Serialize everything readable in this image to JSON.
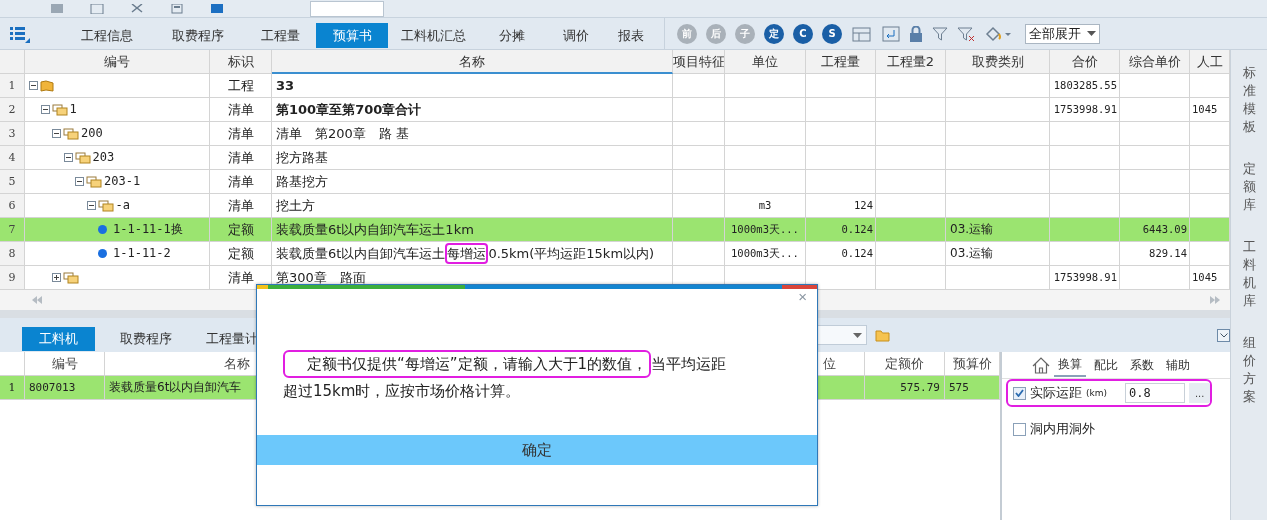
{
  "tabs": [
    {
      "label": "工程信息",
      "selected": false
    },
    {
      "label": "取费程序",
      "selected": false
    },
    {
      "label": "工程量",
      "selected": false
    },
    {
      "label": "预算书",
      "selected": true
    },
    {
      "label": "工料机汇总",
      "selected": false
    },
    {
      "label": "分摊",
      "selected": false
    },
    {
      "label": "调价",
      "selected": false
    },
    {
      "label": "报表",
      "selected": false
    }
  ],
  "tool_buttons": [
    {
      "glyph": "前",
      "disabled": true
    },
    {
      "glyph": "后",
      "disabled": true
    },
    {
      "glyph": "子",
      "disabled": true
    },
    {
      "glyph": "定",
      "disabled": false
    },
    {
      "glyph": "C",
      "disabled": false
    },
    {
      "glyph": "S",
      "disabled": false
    }
  ],
  "expand_dropdown": {
    "value": "全部展开"
  },
  "grid": {
    "columns": [
      "编号",
      "标识",
      "名称",
      "项目特征",
      "单位",
      "工程量",
      "工程量2",
      "取费类别",
      "合价",
      "综合单价",
      "人工"
    ],
    "rows": [
      {
        "number": "1",
        "kind": "project",
        "expanded": true,
        "selected": false,
        "bold": true,
        "mark": "工程",
        "name": "33",
        "total": "1803285.55",
        "children": [
          {
            "number": "2",
            "code": "1",
            "kind": "list",
            "expanded": true,
            "selected": false,
            "bold": true,
            "mark": "清单",
            "name": "第100章至第700章合计",
            "total": "1753998.91",
            "labor": "1045",
            "children": [
              {
                "number": "3",
                "code": "200",
                "kind": "list",
                "expanded": true,
                "selected": false,
                "bold": false,
                "mark": "清单",
                "name": "清单　第200章　路 基",
                "children": [
                  {
                    "number": "4",
                    "code": "203",
                    "kind": "list",
                    "expanded": true,
                    "selected": false,
                    "bold": false,
                    "mark": "清单",
                    "name": "挖方路基",
                    "children": [
                      {
                        "number": "5",
                        "code": "203-1",
                        "kind": "list",
                        "expanded": true,
                        "selected": false,
                        "bold": false,
                        "mark": "清单",
                        "name": "路基挖方",
                        "children": [
                          {
                            "number": "6",
                            "code": "-a",
                            "kind": "list",
                            "expanded": true,
                            "selected": false,
                            "bold": false,
                            "mark": "清单",
                            "name": "挖土方",
                            "unit": "m3",
                            "qty": "124",
                            "children": [
                              {
                                "number": "7",
                                "code": "1-1-11-1换",
                                "kind": "quota",
                                "selected": true,
                                "bold": false,
                                "mark": "定额",
                                "name": "装载质量6t以内自卸汽车运土1km",
                                "unit": "1000m3天...",
                                "qty": "0.124",
                                "fee": "03.运输",
                                "unit_price": "6443.09"
                              },
                              {
                                "number": "8",
                                "code": "1-1-11-2",
                                "kind": "quota",
                                "selected": false,
                                "bold": false,
                                "mark": "定额",
                                "name": "装载质量6t以内自卸汽车运土**每增运**0.5km(平均运距15km以内)",
                                "unit": "1000m3天...",
                                "qty": "0.124",
                                "fee": "03.运输",
                                "unit_price": "829.14"
                              }
                            ]
                          }
                        ]
                      }
                    ]
                  }
                ]
              },
              {
                "number": "9",
                "kind": "list",
                "expanded": false,
                "selected": false,
                "bold": false,
                "mark": "清单",
                "name": "第300章　路面",
                "total": "1753998.91",
                "labor": "1045"
              }
            ]
          }
        ]
      }
    ]
  },
  "side_tabs": [
    "标准模板",
    "定额库",
    "工料机库",
    "组价方案"
  ],
  "bottom": {
    "tabs": [
      {
        "label": "工料机",
        "selected": true
      },
      {
        "label": "取费程序",
        "selected": false
      },
      {
        "label": "工程量计",
        "selected": false
      }
    ],
    "grid": {
      "columns": [
        "编号",
        "名称",
        "位",
        "定额价",
        "预算价"
      ],
      "rows": [
        {
          "number": "1",
          "code": "8007013",
          "name": "装载质量6t以内自卸汽车",
          "quota_price": "575.79",
          "budget_price": "575",
          "selected": true
        }
      ]
    },
    "side": {
      "tabs": [
        {
          "label": "换算",
          "selected": true
        },
        {
          "label": "配比",
          "selected": false
        },
        {
          "label": "系数",
          "selected": false
        },
        {
          "label": "辅助",
          "selected": false
        }
      ],
      "options": [
        {
          "kind": "distance",
          "label": "实际运距",
          "unit": "(km)",
          "checked": true,
          "highlighted": true,
          "value": "0.8",
          "button": "..."
        },
        {
          "kind": "check",
          "label": "洞内用洞外",
          "checked": false,
          "highlighted": false
        }
      ]
    }
  },
  "dialog": {
    "close": "×",
    "message": "**定额书仅提供“每增运”定额，请输入大于1的数值，**当平均运距超过15km时，应按市场价格计算。",
    "button": "确定"
  }
}
